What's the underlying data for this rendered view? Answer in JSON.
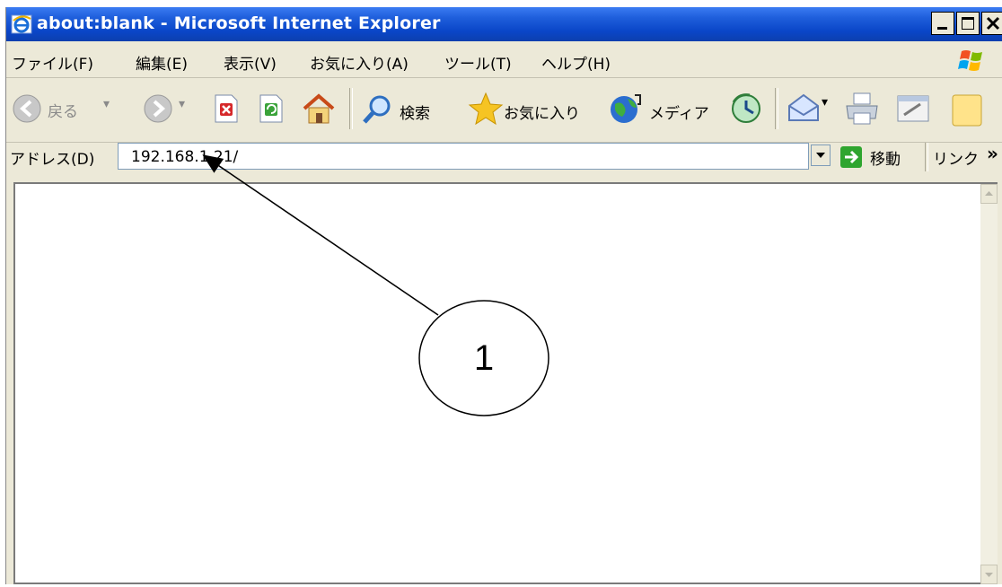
{
  "window": {
    "title": "about:blank - Microsoft Internet Explorer"
  },
  "menu": {
    "items": [
      "ファイル(F)",
      "編集(E)",
      "表示(V)",
      "お気に入り(A)",
      "ツール(T)",
      "ヘルプ(H)"
    ]
  },
  "toolbar": {
    "back_label": "戻る",
    "search_label": "検索",
    "favorites_label": "お気に入り",
    "media_label": "メディア"
  },
  "address": {
    "label": "アドレス(D)",
    "value": "192.168.1.21/",
    "go_label": "移動",
    "links_label": "リンク",
    "more_glyph": "»"
  },
  "callout": {
    "number": "1"
  },
  "colors": {
    "title_bar": "#0a46c8",
    "chrome": "#ece9d8",
    "go_green": "#2fa52f"
  }
}
